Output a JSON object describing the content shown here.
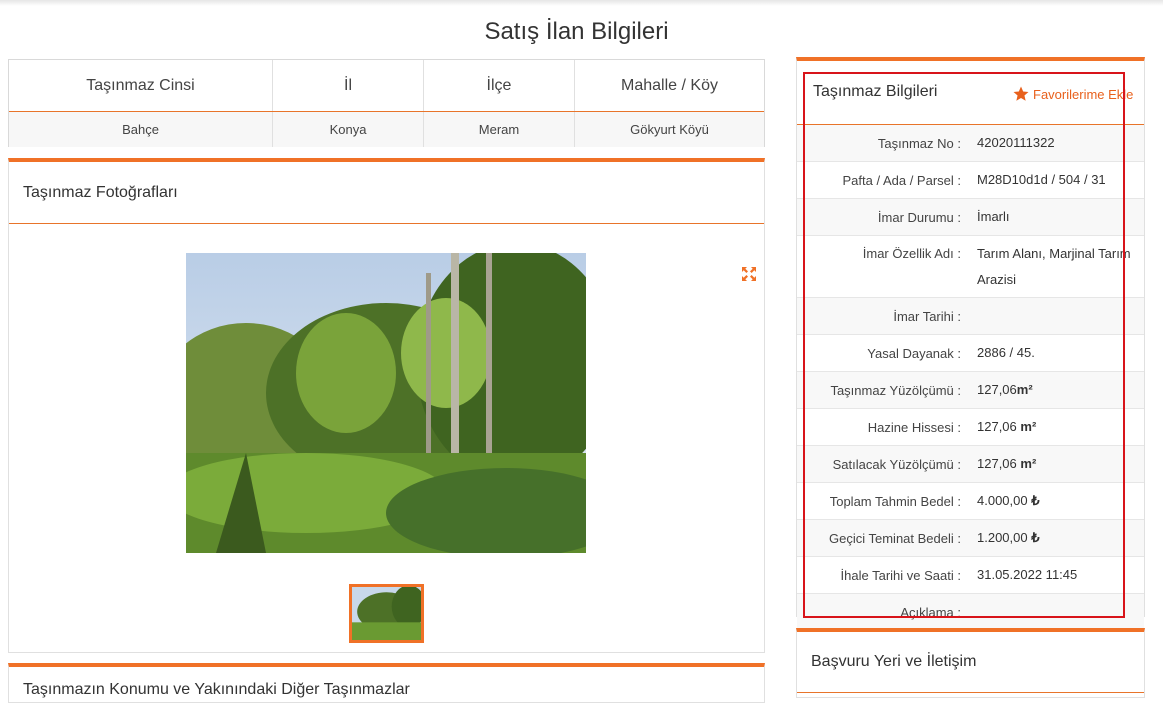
{
  "page": {
    "title": "Satış İlan Bilgileri"
  },
  "summary": {
    "headers": [
      "Taşınmaz Cinsi",
      "İl",
      "İlçe",
      "Mahalle / Köy"
    ],
    "values": [
      "Bahçe",
      "Konya",
      "Meram",
      "Gökyurt Köyü"
    ]
  },
  "photos": {
    "title": "Taşınmaz Fotoğrafları",
    "icons": [
      "expand-icon"
    ]
  },
  "location_panel": {
    "title": "Taşınmazın Konumu ve Yakınındaki Diğer Taşınmazlar"
  },
  "info": {
    "title": "Taşınmaz Bilgileri",
    "favorite_label": "Favorilerime Ekle",
    "rows": [
      {
        "label": "Taşınmaz No :",
        "value": "42020111322"
      },
      {
        "label": "Pafta / Ada / Parsel :",
        "value": "M28D10d1d / 504 / 31"
      },
      {
        "label": "İmar Durumu :",
        "value": "İmarlı"
      },
      {
        "label": "İmar Özellik Adı :",
        "value": "Tarım Alanı, Marjinal Tarım Arazisi"
      },
      {
        "label": "İmar Tarihi :",
        "value": ""
      },
      {
        "label": "Yasal Dayanak :",
        "value": "2886 / 45."
      },
      {
        "label": "Taşınmaz Yüzölçümü :",
        "value": "127,06",
        "unit": "m²"
      },
      {
        "label": "Hazine Hissesi :",
        "value": "127,06 ",
        "unit": "m²"
      },
      {
        "label": "Satılacak Yüzölçümü :",
        "value": "127,06 ",
        "unit": "m²"
      },
      {
        "label": "Toplam Tahmin Bedel :",
        "value": "4.000,00 ",
        "unit": "₺"
      },
      {
        "label": "Geçici Teminat Bedeli :",
        "value": "1.200,00 ",
        "unit": "₺"
      },
      {
        "label": "İhale Tarihi ve Saati :",
        "value": "31.05.2022 11:45"
      },
      {
        "label": "Açıklama :",
        "value": ""
      }
    ]
  },
  "contact": {
    "title": "Başvuru Yeri ve İletişim"
  },
  "colors": {
    "accent": "#f07127",
    "highlight": "#d8141a"
  }
}
